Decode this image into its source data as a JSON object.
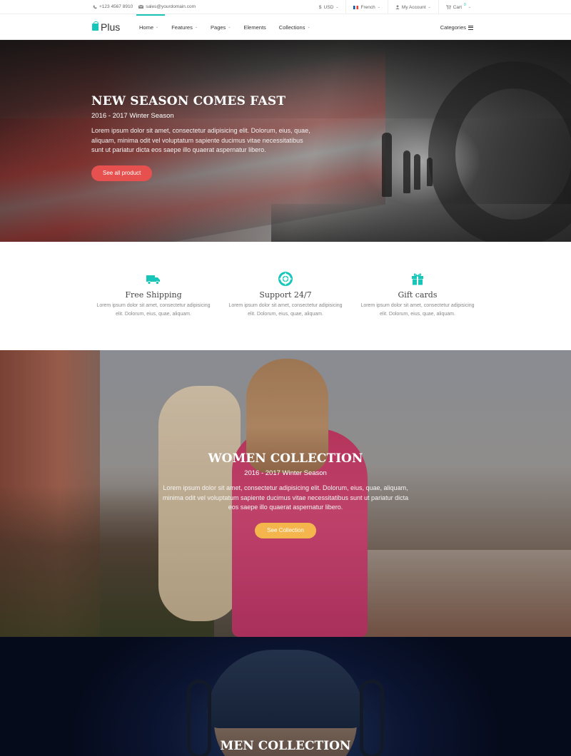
{
  "topbar": {
    "phone": "+123 4567 8910",
    "email": "sales@yourdomain.com",
    "currency": "USD",
    "language": "French",
    "account": "My Account",
    "cart": "Cart",
    "cart_count": "0"
  },
  "nav": {
    "logo": "Plus",
    "items": [
      "Home",
      "Features",
      "Pages",
      "Elements",
      "Collections"
    ],
    "categories": "Categories",
    "accent_color": "#17c6b8"
  },
  "hero": {
    "title": "NEW SEASON COMES FAST",
    "subtitle": "2016 - 2017 Winter Season",
    "description": "Lorem ipsum dolor sit amet, consectetur adipisicing elit. Dolorum, eius, quae, aliquam, minima odit vel voluptatum sapiente ducimus vitae necessitatibus sunt ut pariatur dicta eos saepe illo quaerat aspernatur libero.",
    "button": "See all product",
    "button_color": "#e6514f"
  },
  "features": [
    {
      "icon": "truck-icon",
      "title": "Free Shipping",
      "text": "Lorem ipsum dolor sit amet, consectetur adipisicing elit. Dolorum, eius, quae, aliquam."
    },
    {
      "icon": "lifebuoy-icon",
      "title": "Support 24/7",
      "text": "Lorem ipsum dolor sit amet, consectetur adipisicing elit. Dolorum, eius, quae, aliquam."
    },
    {
      "icon": "gift-icon",
      "title": "Gift cards",
      "text": "Lorem ipsum dolor sit amet, consectetur adipisicing elit. Dolorum, eius, quae, aliquam."
    }
  ],
  "women": {
    "title": "WOMEN COLLECTION",
    "subtitle": "2016 - 2017 Winter Season",
    "description": "Lorem ipsum dolor sit amet, consectetur adipisicing elit. Dolorum, eius, quae, aliquam, minima odit vel voluptatum sapiente ducimus vitae necessitatibus sunt ut pariatur dicta eos saepe illo quaerat aspernatur libero.",
    "button": "See Collection",
    "button_color": "#f4b64c"
  },
  "men": {
    "title": "MEN COLLECTION"
  }
}
